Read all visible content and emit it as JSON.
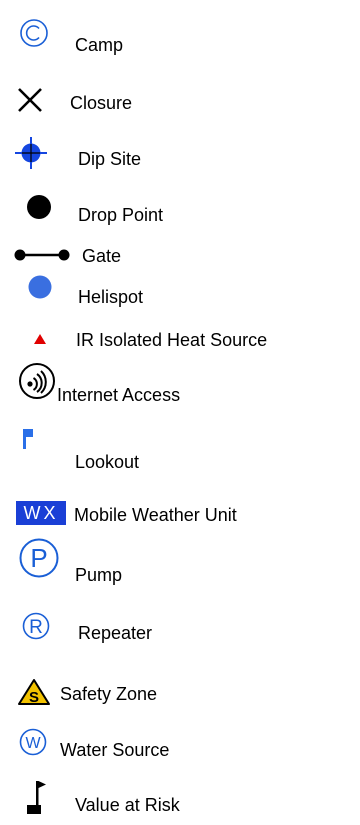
{
  "legend": {
    "camp": {
      "label": "Camp",
      "icon": "camp-icon",
      "color": "#1a5fd6"
    },
    "closure": {
      "label": "Closure",
      "icon": "closure-icon",
      "color": "#000000"
    },
    "dip_site": {
      "label": "Dip Site",
      "icon": "dip-site-icon",
      "color": "#1546e0"
    },
    "drop_point": {
      "label": "Drop Point",
      "icon": "drop-point-icon",
      "color": "#000000"
    },
    "gate": {
      "label": "Gate",
      "icon": "gate-icon",
      "color": "#000000"
    },
    "helispot": {
      "label": "Helispot",
      "icon": "helispot-icon",
      "color": "#3a6fe0"
    },
    "ir_isolated_heat_source": {
      "label": "IR Isolated Heat Source",
      "icon": "ir-heat-source-icon",
      "color": "#e00000"
    },
    "internet_access": {
      "label": "Internet Access",
      "icon": "internet-access-icon",
      "color": "#000000"
    },
    "lookout": {
      "label": "Lookout",
      "icon": "lookout-flag-icon",
      "color": "#2a6fe8"
    },
    "mobile_weather_unit": {
      "label": "Mobile Weather Unit",
      "icon": "mobile-weather-unit-icon",
      "icon_text": "WX",
      "color": "#1a3fd6"
    },
    "pump": {
      "label": "Pump",
      "icon": "pump-icon",
      "icon_text": "P",
      "color": "#1a5fd6"
    },
    "repeater": {
      "label": "Repeater",
      "icon": "repeater-icon",
      "icon_text": "R",
      "color": "#1a5fd6"
    },
    "safety_zone": {
      "label": "Safety Zone",
      "icon": "safety-zone-icon",
      "icon_text": "S",
      "color": "#f2c200"
    },
    "water_source": {
      "label": "Water Source",
      "icon": "water-source-icon",
      "icon_text": "W",
      "color": "#1a5fd6"
    },
    "value_at_risk": {
      "label": "Value at Risk",
      "icon": "value-at-risk-icon",
      "color": "#000000"
    }
  }
}
